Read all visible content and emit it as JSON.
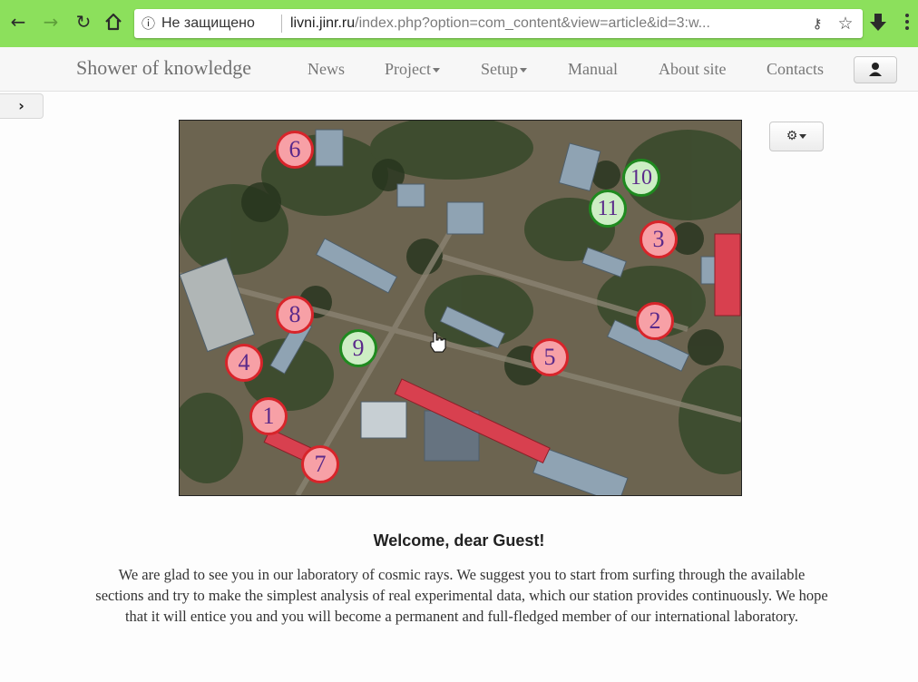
{
  "browser": {
    "security_label": "Не защищено",
    "url_host": "livni.jinr.ru",
    "url_path": "/index.php?option=com_content&view=article&id=3:w..."
  },
  "navbar": {
    "brand": "Shower of knowledge",
    "items": [
      {
        "label": "News"
      },
      {
        "label": "Project"
      },
      {
        "label": "Setup"
      },
      {
        "label": "Manual"
      },
      {
        "label": "About site"
      },
      {
        "label": "Contacts"
      }
    ]
  },
  "map": {
    "markers": [
      {
        "label": "1",
        "status": "red"
      },
      {
        "label": "2",
        "status": "red"
      },
      {
        "label": "3",
        "status": "red"
      },
      {
        "label": "4",
        "status": "red"
      },
      {
        "label": "5",
        "status": "red"
      },
      {
        "label": "6",
        "status": "red"
      },
      {
        "label": "7",
        "status": "red"
      },
      {
        "label": "8",
        "status": "red"
      },
      {
        "label": "9",
        "status": "green"
      },
      {
        "label": "10",
        "status": "green"
      },
      {
        "label": "11",
        "status": "green"
      }
    ]
  },
  "content": {
    "heading": "Welcome, dear Guest!",
    "paragraph": "We are glad to see you in our laboratory of cosmic rays. We suggest you to start from surfing through the available sections and try to make the simplest analysis of real experimental data, which our station provides continuously. We hope that it will entice you and you will become a permanent and full-fledged member of our international laboratory."
  },
  "colors": {
    "chrome_bar": "#8ce05c",
    "marker_red_fill": "#f7a0a6",
    "marker_red_ring": "#d8242a",
    "marker_green_fill": "#cdeec4",
    "marker_green_ring": "#1f8a1f",
    "marker_text": "#5a2a8a"
  }
}
